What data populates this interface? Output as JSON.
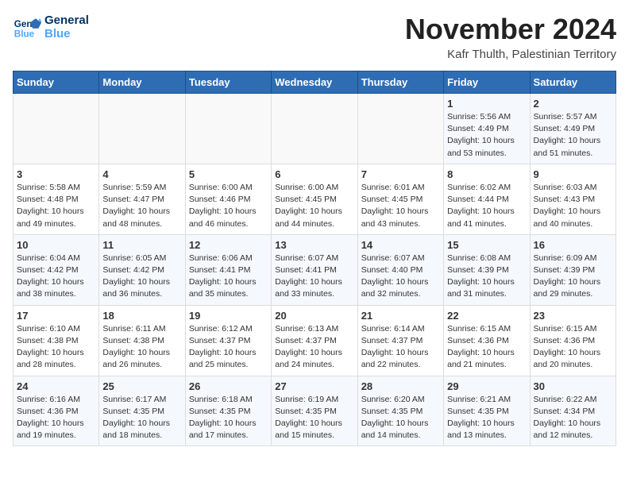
{
  "header": {
    "logo_line1": "General",
    "logo_line2": "Blue",
    "month_year": "November 2024",
    "location": "Kafr Thulth, Palestinian Territory"
  },
  "days_of_week": [
    "Sunday",
    "Monday",
    "Tuesday",
    "Wednesday",
    "Thursday",
    "Friday",
    "Saturday"
  ],
  "weeks": [
    [
      {
        "day": "",
        "info": ""
      },
      {
        "day": "",
        "info": ""
      },
      {
        "day": "",
        "info": ""
      },
      {
        "day": "",
        "info": ""
      },
      {
        "day": "",
        "info": ""
      },
      {
        "day": "1",
        "info": "Sunrise: 5:56 AM\nSunset: 4:49 PM\nDaylight: 10 hours and 53 minutes."
      },
      {
        "day": "2",
        "info": "Sunrise: 5:57 AM\nSunset: 4:49 PM\nDaylight: 10 hours and 51 minutes."
      }
    ],
    [
      {
        "day": "3",
        "info": "Sunrise: 5:58 AM\nSunset: 4:48 PM\nDaylight: 10 hours and 49 minutes."
      },
      {
        "day": "4",
        "info": "Sunrise: 5:59 AM\nSunset: 4:47 PM\nDaylight: 10 hours and 48 minutes."
      },
      {
        "day": "5",
        "info": "Sunrise: 6:00 AM\nSunset: 4:46 PM\nDaylight: 10 hours and 46 minutes."
      },
      {
        "day": "6",
        "info": "Sunrise: 6:00 AM\nSunset: 4:45 PM\nDaylight: 10 hours and 44 minutes."
      },
      {
        "day": "7",
        "info": "Sunrise: 6:01 AM\nSunset: 4:45 PM\nDaylight: 10 hours and 43 minutes."
      },
      {
        "day": "8",
        "info": "Sunrise: 6:02 AM\nSunset: 4:44 PM\nDaylight: 10 hours and 41 minutes."
      },
      {
        "day": "9",
        "info": "Sunrise: 6:03 AM\nSunset: 4:43 PM\nDaylight: 10 hours and 40 minutes."
      }
    ],
    [
      {
        "day": "10",
        "info": "Sunrise: 6:04 AM\nSunset: 4:42 PM\nDaylight: 10 hours and 38 minutes."
      },
      {
        "day": "11",
        "info": "Sunrise: 6:05 AM\nSunset: 4:42 PM\nDaylight: 10 hours and 36 minutes."
      },
      {
        "day": "12",
        "info": "Sunrise: 6:06 AM\nSunset: 4:41 PM\nDaylight: 10 hours and 35 minutes."
      },
      {
        "day": "13",
        "info": "Sunrise: 6:07 AM\nSunset: 4:41 PM\nDaylight: 10 hours and 33 minutes."
      },
      {
        "day": "14",
        "info": "Sunrise: 6:07 AM\nSunset: 4:40 PM\nDaylight: 10 hours and 32 minutes."
      },
      {
        "day": "15",
        "info": "Sunrise: 6:08 AM\nSunset: 4:39 PM\nDaylight: 10 hours and 31 minutes."
      },
      {
        "day": "16",
        "info": "Sunrise: 6:09 AM\nSunset: 4:39 PM\nDaylight: 10 hours and 29 minutes."
      }
    ],
    [
      {
        "day": "17",
        "info": "Sunrise: 6:10 AM\nSunset: 4:38 PM\nDaylight: 10 hours and 28 minutes."
      },
      {
        "day": "18",
        "info": "Sunrise: 6:11 AM\nSunset: 4:38 PM\nDaylight: 10 hours and 26 minutes."
      },
      {
        "day": "19",
        "info": "Sunrise: 6:12 AM\nSunset: 4:37 PM\nDaylight: 10 hours and 25 minutes."
      },
      {
        "day": "20",
        "info": "Sunrise: 6:13 AM\nSunset: 4:37 PM\nDaylight: 10 hours and 24 minutes."
      },
      {
        "day": "21",
        "info": "Sunrise: 6:14 AM\nSunset: 4:37 PM\nDaylight: 10 hours and 22 minutes."
      },
      {
        "day": "22",
        "info": "Sunrise: 6:15 AM\nSunset: 4:36 PM\nDaylight: 10 hours and 21 minutes."
      },
      {
        "day": "23",
        "info": "Sunrise: 6:15 AM\nSunset: 4:36 PM\nDaylight: 10 hours and 20 minutes."
      }
    ],
    [
      {
        "day": "24",
        "info": "Sunrise: 6:16 AM\nSunset: 4:36 PM\nDaylight: 10 hours and 19 minutes."
      },
      {
        "day": "25",
        "info": "Sunrise: 6:17 AM\nSunset: 4:35 PM\nDaylight: 10 hours and 18 minutes."
      },
      {
        "day": "26",
        "info": "Sunrise: 6:18 AM\nSunset: 4:35 PM\nDaylight: 10 hours and 17 minutes."
      },
      {
        "day": "27",
        "info": "Sunrise: 6:19 AM\nSunset: 4:35 PM\nDaylight: 10 hours and 15 minutes."
      },
      {
        "day": "28",
        "info": "Sunrise: 6:20 AM\nSunset: 4:35 PM\nDaylight: 10 hours and 14 minutes."
      },
      {
        "day": "29",
        "info": "Sunrise: 6:21 AM\nSunset: 4:35 PM\nDaylight: 10 hours and 13 minutes."
      },
      {
        "day": "30",
        "info": "Sunrise: 6:22 AM\nSunset: 4:34 PM\nDaylight: 10 hours and 12 minutes."
      }
    ]
  ]
}
